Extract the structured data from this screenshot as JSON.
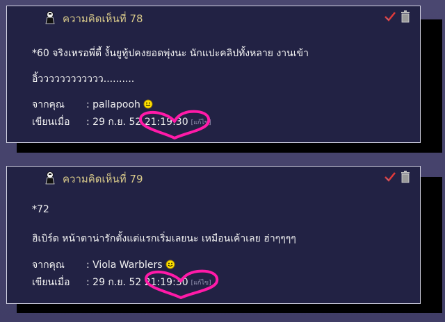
{
  "comments": [
    {
      "title": "ความคิดเห็นที่ 78",
      "lines": [
        "*60  จริงเหรอพี่ดี้  งั้นยูทู้ปคงยอดพุ่งนะ  นักแปะคลิปทั้งหลาย  งานเข้า",
        "อิ้วววววววววววว.........."
      ],
      "from_label": "จากคุณ",
      "from_value": ": pallapooh",
      "date_label": "เขียนเมื่อ",
      "date_value": ": 29 ก.ย. 52 21:19:30",
      "edit_link": "[แก้ไข]"
    },
    {
      "title": "ความคิดเห็นที่ 79",
      "lines": [
        "*72",
        "ฮิเบิร์ด หน้าตาน่ารักตั้งแต่แรกเริ่มเลยนะ เหมือนเค้าเลย ฮ่าๆๆๆๆ"
      ],
      "from_label": "จากคุณ",
      "from_value": ": Viola Warblers",
      "date_label": "เขียนเมื่อ",
      "date_value": ": 29 ก.ย. 52 21:19:30",
      "edit_link": "[แก้ไข]"
    }
  ],
  "colors": {
    "card_bg": "#222244",
    "title": "#d8c98a",
    "heart": "#ff1aa8"
  },
  "icons": [
    "user-avatar-icon",
    "approve-check-icon",
    "trash-icon",
    "smiley-icon",
    "heart-doodle"
  ]
}
